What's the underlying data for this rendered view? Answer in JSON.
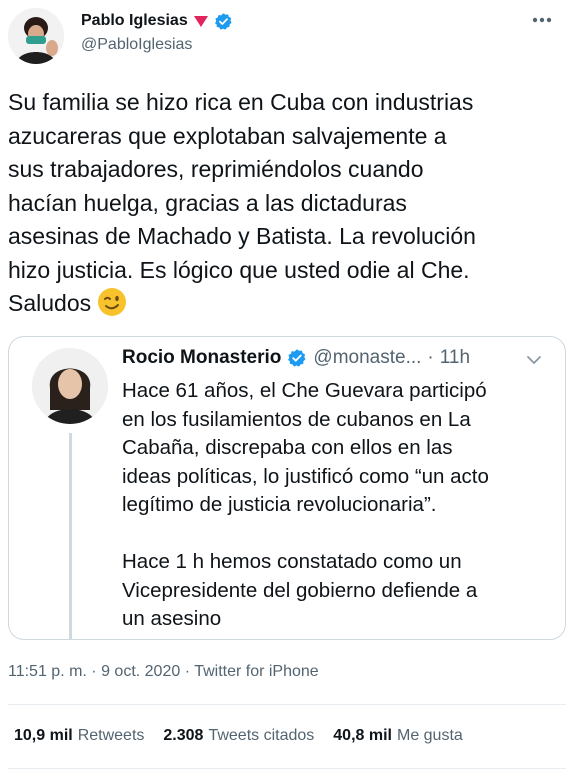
{
  "tweet": {
    "author": {
      "name": "Pablo Iglesias",
      "handle": "@PabloIglesias"
    },
    "lines": [
      "Su familia se hizo rica en Cuba con industrias",
      "azucareras que explotaban salvajemente a",
      "sus trabajadores, reprimiéndolos  cuando",
      "hacían huelga, gracias a las dictaduras",
      "asesinas de Machado y Batista. La revolución",
      "hizo justicia. Es lógico que usted odie al Che.",
      "Saludos"
    ],
    "emoji": "wink-face",
    "quoted": {
      "name": "Rocio Monasterio",
      "handle": "@monaste...",
      "dot": "·",
      "time": "11h",
      "paragraph1": [
        "Hace 61 años, el Che Guevara participó",
        "en los fusilamientos de cubanos en La",
        "Cabaña, discrepaba con ellos en las",
        "ideas políticas, lo justificó como “un acto",
        "legítimo de justicia revolucionaria”."
      ],
      "paragraph2": [
        "Hace 1 h hemos constatado como un",
        "Vicepresidente del gobierno defiende a",
        "un asesino"
      ]
    },
    "meta": {
      "time": "11:51 p. m.",
      "sep1": " · ",
      "date": "9 oct. 2020",
      "sep2": " · ",
      "source": "Twitter for iPhone"
    },
    "stats": [
      {
        "value": "10,9 mil",
        "label": "Retweets"
      },
      {
        "value": "2.308",
        "label": "Tweets citados"
      },
      {
        "value": "40,8 mil",
        "label": "Me gusta"
      }
    ]
  },
  "colors": {
    "verified": "#1d9bf0",
    "heart": "#e0245e",
    "secondary_text": "#536471",
    "border": "#cfd9de"
  }
}
